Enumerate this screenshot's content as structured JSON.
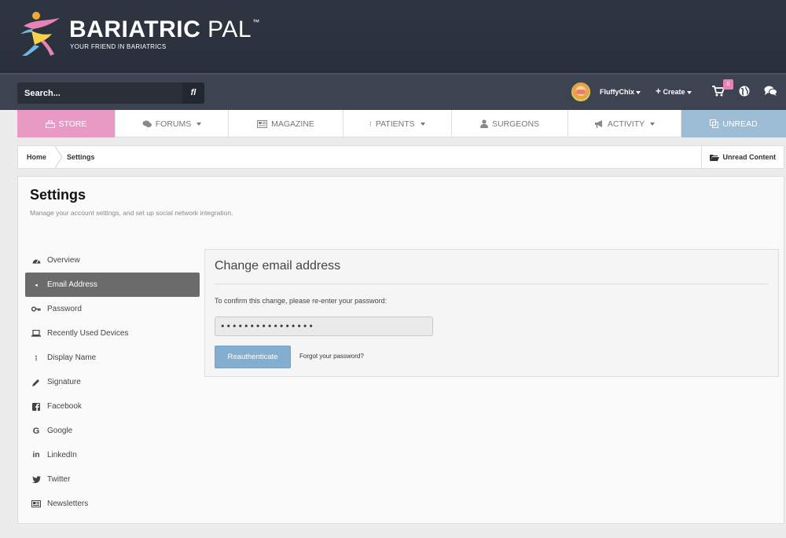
{
  "brand": {
    "name_bold": "BARIATRIC",
    "name_thin": "PAL",
    "tm": "™",
    "tagline": "YOUR FRIEND IN BARIATRICS"
  },
  "userbar": {
    "search_placeholder": "Search...",
    "search_button": "fl",
    "username": "FluffyChix",
    "create_label": "Create",
    "cart_count": "0"
  },
  "nav": {
    "items": [
      {
        "label": "STORE",
        "icon": "store-icon"
      },
      {
        "label": "FORUMS",
        "icon": "comments-icon",
        "dropdown": true
      },
      {
        "label": "MAGAZINE",
        "icon": "newspaper-icon"
      },
      {
        "label": "PATIENTS",
        "icon": "dots-icon",
        "dropdown": true
      },
      {
        "label": "SURGEONS",
        "icon": "user-md-icon"
      },
      {
        "label": "ACTIVITY",
        "icon": "bullhorn-icon",
        "dropdown": true
      },
      {
        "label": "UNREAD",
        "icon": "copy-icon"
      }
    ]
  },
  "breadcrumb": {
    "home": "Home",
    "current": "Settings",
    "unread_content": "Unread Content"
  },
  "page": {
    "title": "Settings",
    "subtitle": "Manage your account settings, and set up social network integration."
  },
  "sidemenu": {
    "items": [
      {
        "label": "Overview",
        "icon": "dashboard-icon"
      },
      {
        "label": "Email Address",
        "icon": "envelope-icon",
        "active": true
      },
      {
        "label": "Password",
        "icon": "key-icon"
      },
      {
        "label": "Recently Used Devices",
        "icon": "laptop-icon"
      },
      {
        "label": "Display Name",
        "icon": "id-icon"
      },
      {
        "label": "Signature",
        "icon": "pencil-icon"
      },
      {
        "label": "Facebook",
        "icon": "facebook-icon"
      },
      {
        "label": "Google",
        "icon": "google-icon"
      },
      {
        "label": "LinkedIn",
        "icon": "linkedin-icon"
      },
      {
        "label": "Twitter",
        "icon": "twitter-icon"
      },
      {
        "label": "Newsletters",
        "icon": "newsletter-icon"
      }
    ]
  },
  "form": {
    "title": "Change email address",
    "instruction": "To confirm this change, please re-enter your password:",
    "password_value": "••••••••••••••••",
    "submit_label": "Reauthenticate",
    "forgot_label": "Forgot your password?"
  },
  "colors": {
    "header_bg": "#2e3440",
    "store_pink": "#e99ac4",
    "unread_blue": "#9dbdd6",
    "button_blue": "#84aed0",
    "active_gray": "#6b6b6b"
  }
}
